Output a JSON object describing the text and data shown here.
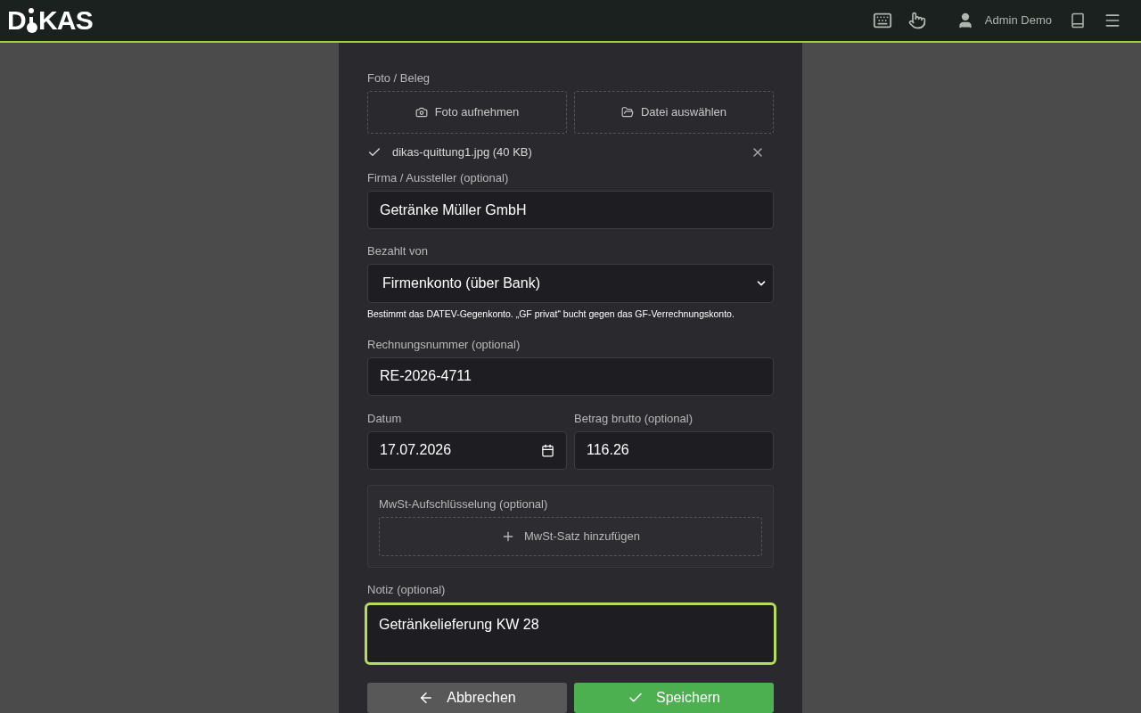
{
  "header": {
    "logo": {
      "left": "D",
      "right": "KAS"
    },
    "user": "Admin Demo"
  },
  "form": {
    "photo_label": "Foto / Beleg",
    "upload_buttons": [
      {
        "kind": "camera",
        "label": "Foto aufnehmen"
      },
      {
        "kind": "folder",
        "label": "Datei auswählen"
      }
    ],
    "attached_file": "dikas-quittung1.jpg (40 KB)",
    "company": {
      "label": "Firma / Aussteller (optional)",
      "value": "Getränke Müller GmbH"
    },
    "paid_by": {
      "label": "Bezahlt von",
      "value": "Firmenkonto (über Bank)",
      "hint": "Bestimmt das DATEV-Gegenkonto. „GF privat“ bucht gegen das GF-Verrechnungskonto."
    },
    "invoice_number": {
      "label": "Rechnungsnummer (optional)",
      "value": "RE-2026-4711"
    },
    "date": {
      "label": "Datum",
      "value": "17.07.2026"
    },
    "gross": {
      "label": "Betrag brutto (optional)",
      "value": "116.26"
    },
    "vat": {
      "label": "MwSt-Aufschlüsselung (optional)",
      "add_button": "MwSt-Satz hinzufügen"
    },
    "note": {
      "label": "Notiz (optional)",
      "value": "Getränkelieferung KW 28",
      "focused": true
    },
    "actions": [
      {
        "kind": "cancel",
        "label": "Abbrechen"
      },
      {
        "kind": "save",
        "label": "Speichern"
      }
    ]
  }
}
